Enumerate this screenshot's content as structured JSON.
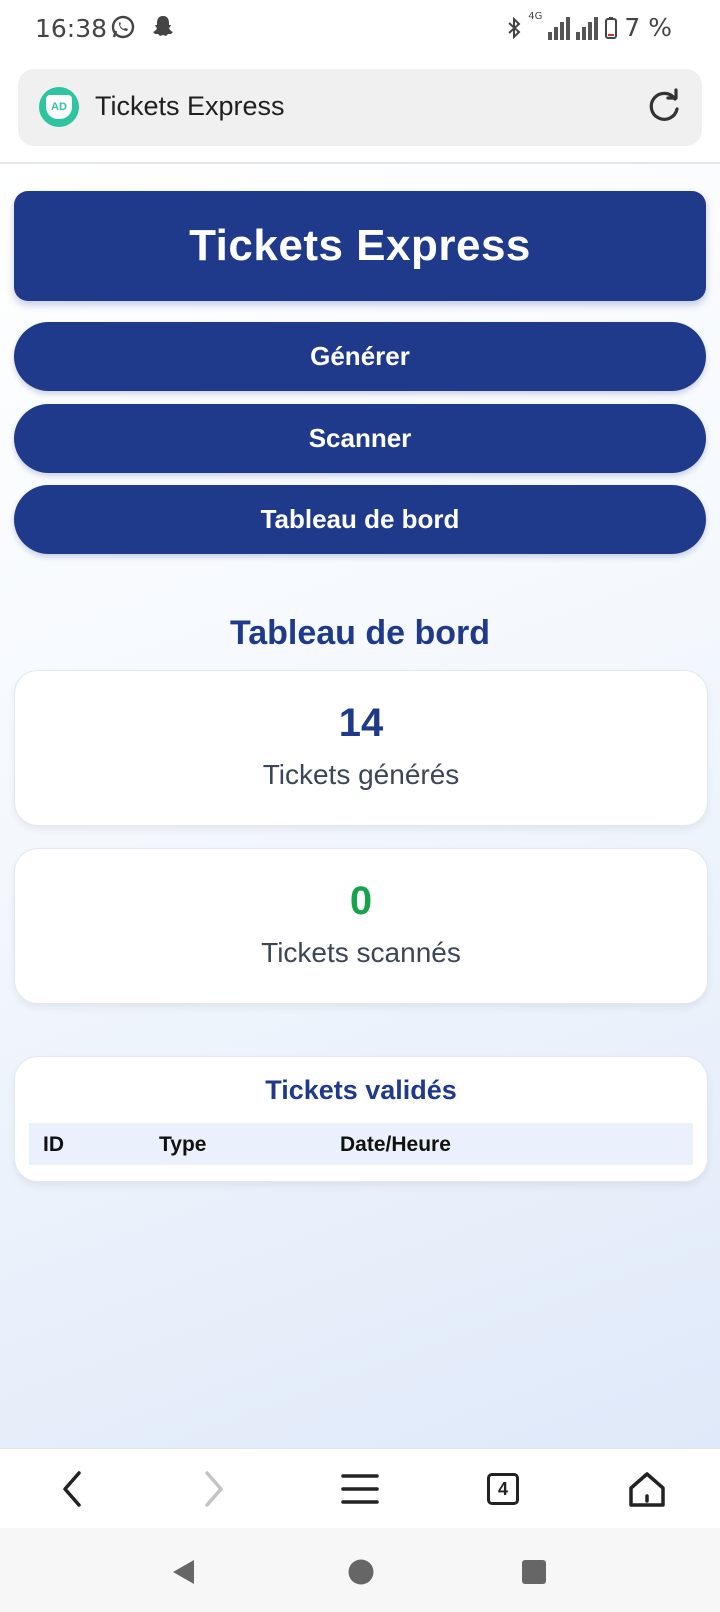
{
  "status_bar": {
    "time": "16:38",
    "left_icons": [
      "whatsapp-icon",
      "snapchat-icon"
    ],
    "network": "4G",
    "battery": "7 %"
  },
  "browser": {
    "site_icon_text": "AD",
    "title": "Tickets Express",
    "tab_count": "4"
  },
  "app": {
    "header_title": "Tickets Express",
    "nav_buttons": [
      "Générer",
      "Scanner",
      "Tableau de bord"
    ],
    "section_title": "Tableau de bord",
    "stats": [
      {
        "value": "14",
        "label": "Tickets générés",
        "color": "#1f3a8a"
      },
      {
        "value": "0",
        "label": "Tickets scannés",
        "color": "#17a34a"
      }
    ],
    "table": {
      "title": "Tickets validés",
      "columns": [
        "ID",
        "Type",
        "Date/Heure"
      ],
      "rows": []
    }
  },
  "colors": {
    "primary": "#1f3a8a",
    "success": "#17a34a",
    "site_icon": "#2ec4a0"
  }
}
